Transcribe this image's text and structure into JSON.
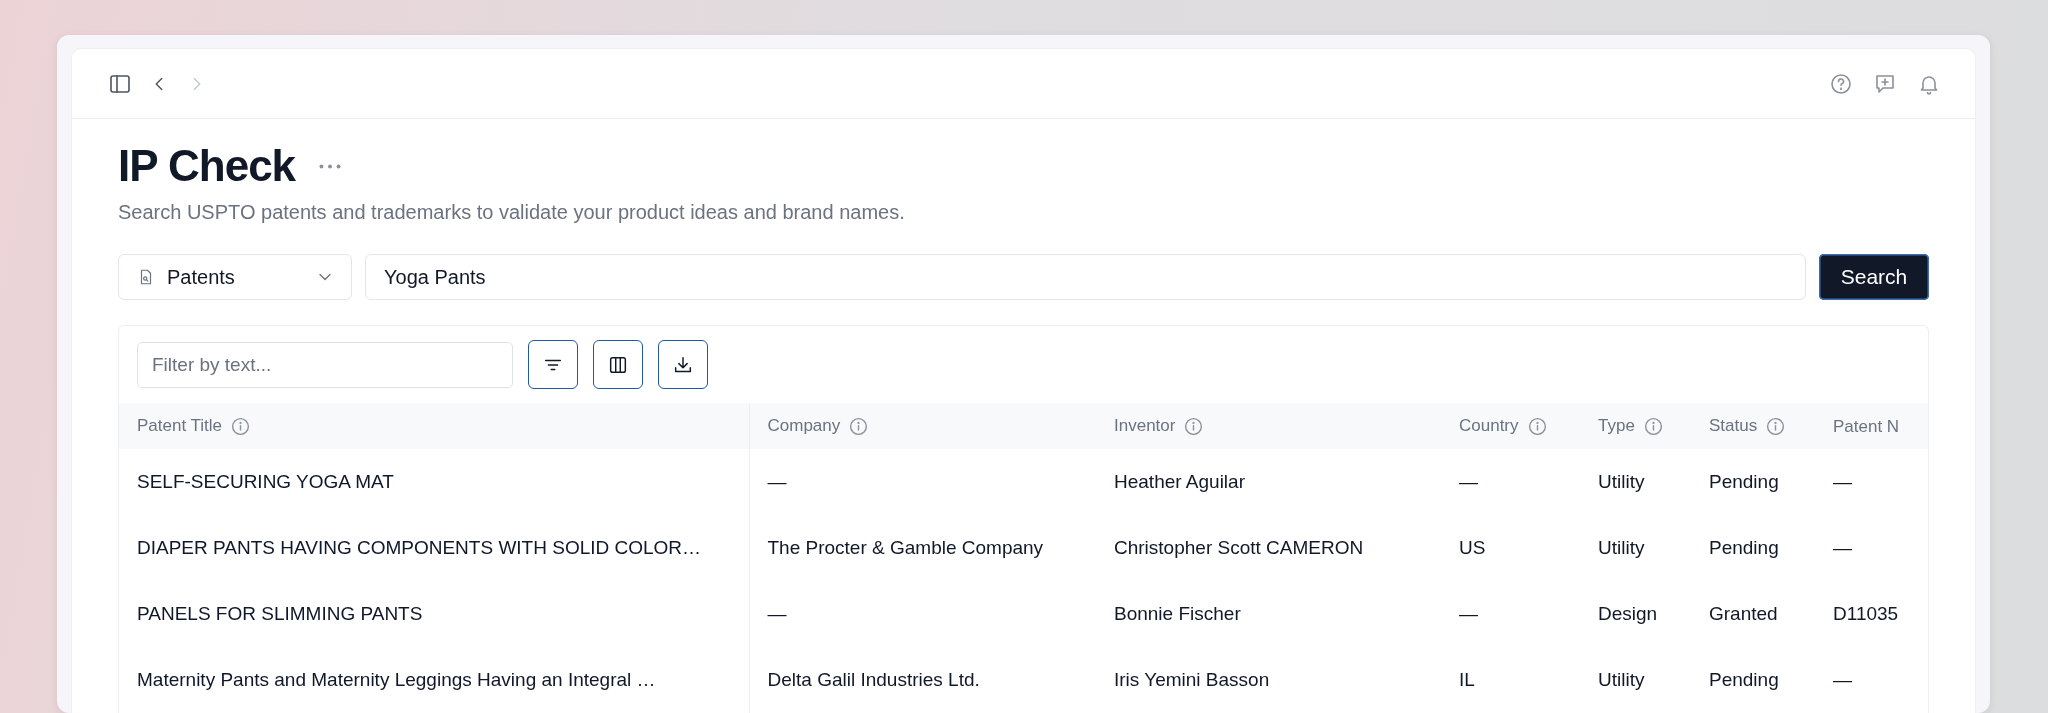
{
  "nav": {
    "back_disabled": false,
    "forward_disabled": true
  },
  "page": {
    "title": "IP Check",
    "subtitle": "Search USPTO patents and trademarks to validate your product ideas and brand names."
  },
  "search": {
    "source": "Patents",
    "query": "Yoga Pants",
    "button": "Search"
  },
  "table": {
    "filter_placeholder": "Filter by text...",
    "columns": [
      "Patent Title",
      "Company",
      "Inventor",
      "Country",
      "Type",
      "Status",
      "Patent N"
    ],
    "rows": [
      [
        "SELF-SECURING YOGA MAT",
        "—",
        "Heather Aguilar",
        "—",
        "Utility",
        "Pending",
        "—"
      ],
      [
        "DIAPER PANTS HAVING COMPONENTS WITH SOLID COLOR…",
        "The Procter & Gamble Company",
        "Christopher Scott CAMERON",
        "US",
        "Utility",
        "Pending",
        "—"
      ],
      [
        "PANELS FOR SLIMMING PANTS",
        "—",
        "Bonnie Fischer",
        "—",
        "Design",
        "Granted",
        "D11035"
      ],
      [
        "Maternity Pants and Maternity Leggings Having an Integral …",
        "Delta Galil Industries Ltd.",
        "Iris Yemini Basson",
        "IL",
        "Utility",
        "Pending",
        "—"
      ]
    ]
  }
}
